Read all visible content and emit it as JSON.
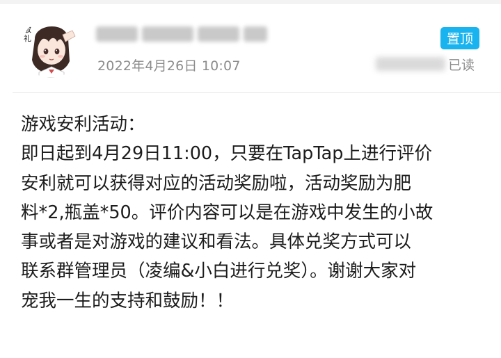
{
  "post": {
    "timestamp": "2022年4月26日 10:07",
    "pin_label": "置顶",
    "read_label": "已读",
    "avatar_caption": "敬礼",
    "body_lines": [
      "游戏安利活动：",
      "即日起到4月29日11:00，只要在TapTap上进行评价",
      "安利就可以获得对应的活动奖励啦，活动奖励为肥",
      "料*2,瓶盖*50。评价内容可以是在游戏中发生的小故",
      "事或者是对游戏的建议和看法。具体兑奖方式可以",
      "联系群管理员（凌编&小白进行兑奖）。谢谢大家对",
      "宠我一生的支持和鼓励！！"
    ]
  },
  "colors": {
    "pin_badge": "#19b4ef",
    "meta_text": "#8c8c8c",
    "body_text": "#1c1c1c"
  }
}
